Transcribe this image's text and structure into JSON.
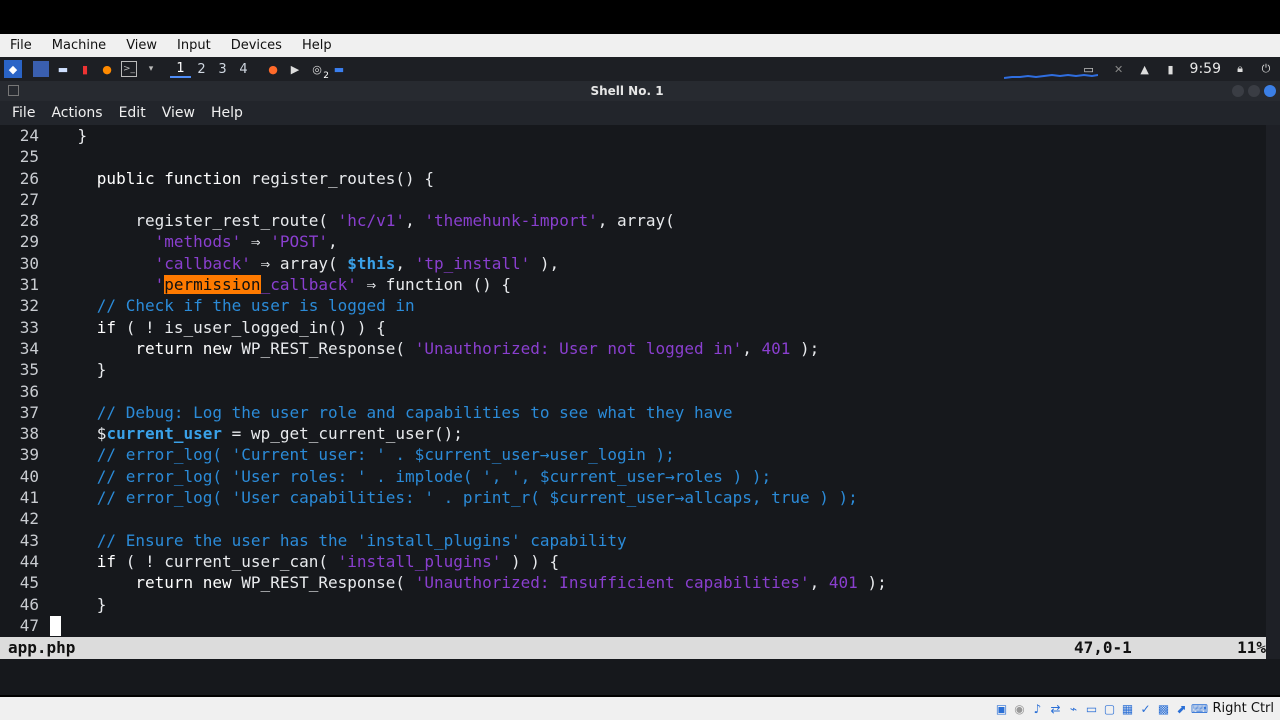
{
  "vbox_menu": [
    "File",
    "Machine",
    "View",
    "Input",
    "Devices",
    "Help"
  ],
  "panel": {
    "workspaces": [
      "1",
      "2",
      "3",
      "4"
    ],
    "active_workspace": "1",
    "clock": "9:59",
    "badge": "2"
  },
  "window": {
    "title": "Shell No. 1"
  },
  "terminal_menu": [
    "File",
    "Actions",
    "Edit",
    "View",
    "Help"
  ],
  "editor": {
    "lines": [
      {
        "n": "24",
        "parts": [
          [
            "txt",
            "    }"
          ]
        ]
      },
      {
        "n": "25",
        "parts": []
      },
      {
        "n": "26",
        "parts": [
          [
            "txt",
            "      "
          ],
          [
            "kw",
            "public function"
          ],
          [
            "txt",
            " register_routes() {"
          ]
        ]
      },
      {
        "n": "27",
        "parts": []
      },
      {
        "n": "28",
        "parts": [
          [
            "txt",
            "          register_rest_route( "
          ],
          [
            "str",
            "'hc/v1'"
          ],
          [
            "txt",
            ", "
          ],
          [
            "str",
            "'themehunk-import'"
          ],
          [
            "txt",
            ", array("
          ]
        ]
      },
      {
        "n": "29",
        "parts": [
          [
            "txt",
            "            "
          ],
          [
            "str",
            "'methods'"
          ],
          [
            "txt",
            " ⇒ "
          ],
          [
            "str",
            "'POST'"
          ],
          [
            "txt",
            ","
          ]
        ]
      },
      {
        "n": "30",
        "parts": [
          [
            "txt",
            "            "
          ],
          [
            "str",
            "'callback'"
          ],
          [
            "txt",
            " ⇒ array( "
          ],
          [
            "var",
            "$this"
          ],
          [
            "txt",
            ", "
          ],
          [
            "str",
            "'tp_install'"
          ],
          [
            "txt",
            " ),"
          ]
        ]
      },
      {
        "n": "31",
        "parts": [
          [
            "txt",
            "            "
          ],
          [
            "str",
            "'"
          ],
          [
            "hl",
            "permission"
          ],
          [
            "str",
            "_callback'"
          ],
          [
            "txt",
            " ⇒ function () {"
          ]
        ]
      },
      {
        "n": "32",
        "parts": [
          [
            "txt",
            "      "
          ],
          [
            "cmt",
            "// Check if the user is logged in"
          ]
        ]
      },
      {
        "n": "33",
        "parts": [
          [
            "txt",
            "      "
          ],
          [
            "kw",
            "if"
          ],
          [
            "txt",
            " ( ! is_user_logged_in() ) {"
          ]
        ]
      },
      {
        "n": "34",
        "parts": [
          [
            "txt",
            "          "
          ],
          [
            "kw",
            "return new"
          ],
          [
            "txt",
            " WP_REST_Response( "
          ],
          [
            "str",
            "'Unauthorized: User not logged in'"
          ],
          [
            "txt",
            ", "
          ],
          [
            "str",
            "401"
          ],
          [
            "txt",
            " );"
          ]
        ]
      },
      {
        "n": "35",
        "parts": [
          [
            "txt",
            "      }"
          ]
        ]
      },
      {
        "n": "36",
        "parts": []
      },
      {
        "n": "37",
        "parts": [
          [
            "txt",
            "      "
          ],
          [
            "cmt",
            "// Debug: Log the user role and capabilities to see what they have"
          ]
        ]
      },
      {
        "n": "38",
        "parts": [
          [
            "txt",
            "      $"
          ],
          [
            "var",
            "current_user"
          ],
          [
            "txt",
            " = wp_get_current_user();"
          ]
        ]
      },
      {
        "n": "39",
        "parts": [
          [
            "txt",
            "      "
          ],
          [
            "cmt",
            "// error_log( 'Current user: ' . $current_user→user_login );"
          ]
        ]
      },
      {
        "n": "40",
        "parts": [
          [
            "txt",
            "      "
          ],
          [
            "cmt",
            "// error_log( 'User roles: ' . implode( ', ', $current_user→roles ) );"
          ]
        ]
      },
      {
        "n": "41",
        "parts": [
          [
            "txt",
            "      "
          ],
          [
            "cmt",
            "// error_log( 'User capabilities: ' . print_r( $current_user→allcaps, true ) );"
          ]
        ]
      },
      {
        "n": "42",
        "parts": []
      },
      {
        "n": "43",
        "parts": [
          [
            "txt",
            "      "
          ],
          [
            "cmt",
            "// Ensure the user has the 'install_plugins' capability"
          ]
        ]
      },
      {
        "n": "44",
        "parts": [
          [
            "txt",
            "      "
          ],
          [
            "kw",
            "if"
          ],
          [
            "txt",
            " ( ! current_user_can( "
          ],
          [
            "str",
            "'install_plugins'"
          ],
          [
            "txt",
            " ) ) {"
          ]
        ]
      },
      {
        "n": "45",
        "parts": [
          [
            "txt",
            "          "
          ],
          [
            "kw",
            "return new"
          ],
          [
            "txt",
            " WP_REST_Response( "
          ],
          [
            "str",
            "'Unauthorized: Insufficient capabilities'"
          ],
          [
            "txt",
            ", "
          ],
          [
            "str",
            "401"
          ],
          [
            "txt",
            " );"
          ]
        ]
      },
      {
        "n": "46",
        "parts": [
          [
            "txt",
            "      }"
          ]
        ]
      },
      {
        "n": "47",
        "parts": []
      }
    ],
    "status": {
      "file": "app.php",
      "position": "47,0-1",
      "percent": "11%"
    }
  },
  "host_key": "Right Ctrl"
}
